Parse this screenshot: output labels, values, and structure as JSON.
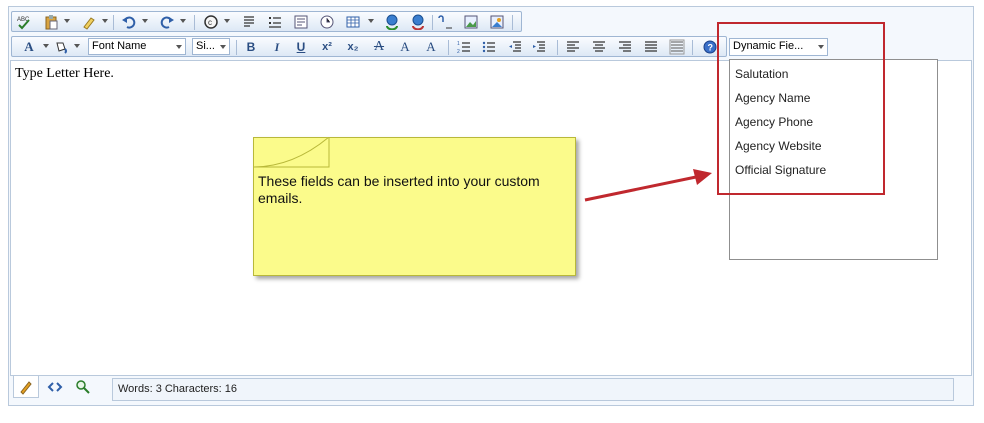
{
  "toolbar_top": {
    "icons": [
      "spellcheck-icon",
      "paste-icon",
      "format-painter-icon",
      "undo-icon",
      "redo-icon",
      "copyright-symbol-icon",
      "insert-paragraph-icon",
      "insert-list-icon",
      "insert-template-icon",
      "insert-date-icon",
      "insert-table-icon",
      "hyperlink-icon",
      "remove-link-icon",
      "insert-special-icon",
      "image-manager-icon",
      "image-map-icon"
    ]
  },
  "toolbar_bottom": {
    "font_name": "Font Name",
    "font_size": "Si...",
    "dynamic_fields": "Dynamic Fie...",
    "icons": [
      "font-color-icon",
      "back-color-icon",
      "bold-icon",
      "italic-icon",
      "underline-icon",
      "superscript-icon",
      "subscript-icon",
      "strikethrough-icon",
      "clear-format-icon",
      "clear-style-icon",
      "numbered-list-icon",
      "bullet-list-icon",
      "outdent-icon",
      "indent-icon",
      "align-left-icon",
      "align-center-icon",
      "align-right-icon",
      "justify-icon",
      "remove-alignment-icon",
      "help-icon"
    ]
  },
  "editor": {
    "text": "Type Letter Here."
  },
  "dynamic_field_options": [
    "Salutation",
    "Agency Name",
    "Agency Phone",
    "Agency Website",
    "Official Signature"
  ],
  "callout": {
    "text": "These fields can be inserted into your custom emails."
  },
  "status": {
    "text": "Words: 3 Characters: 16"
  },
  "mode_tabs": [
    "design-mode-icon",
    "html-mode-icon",
    "preview-mode-icon"
  ],
  "colors": {
    "annotation_red": "#c0282e",
    "note_yellow": "#fbfb8b",
    "toolbar_blue": "#9fb6d3"
  }
}
